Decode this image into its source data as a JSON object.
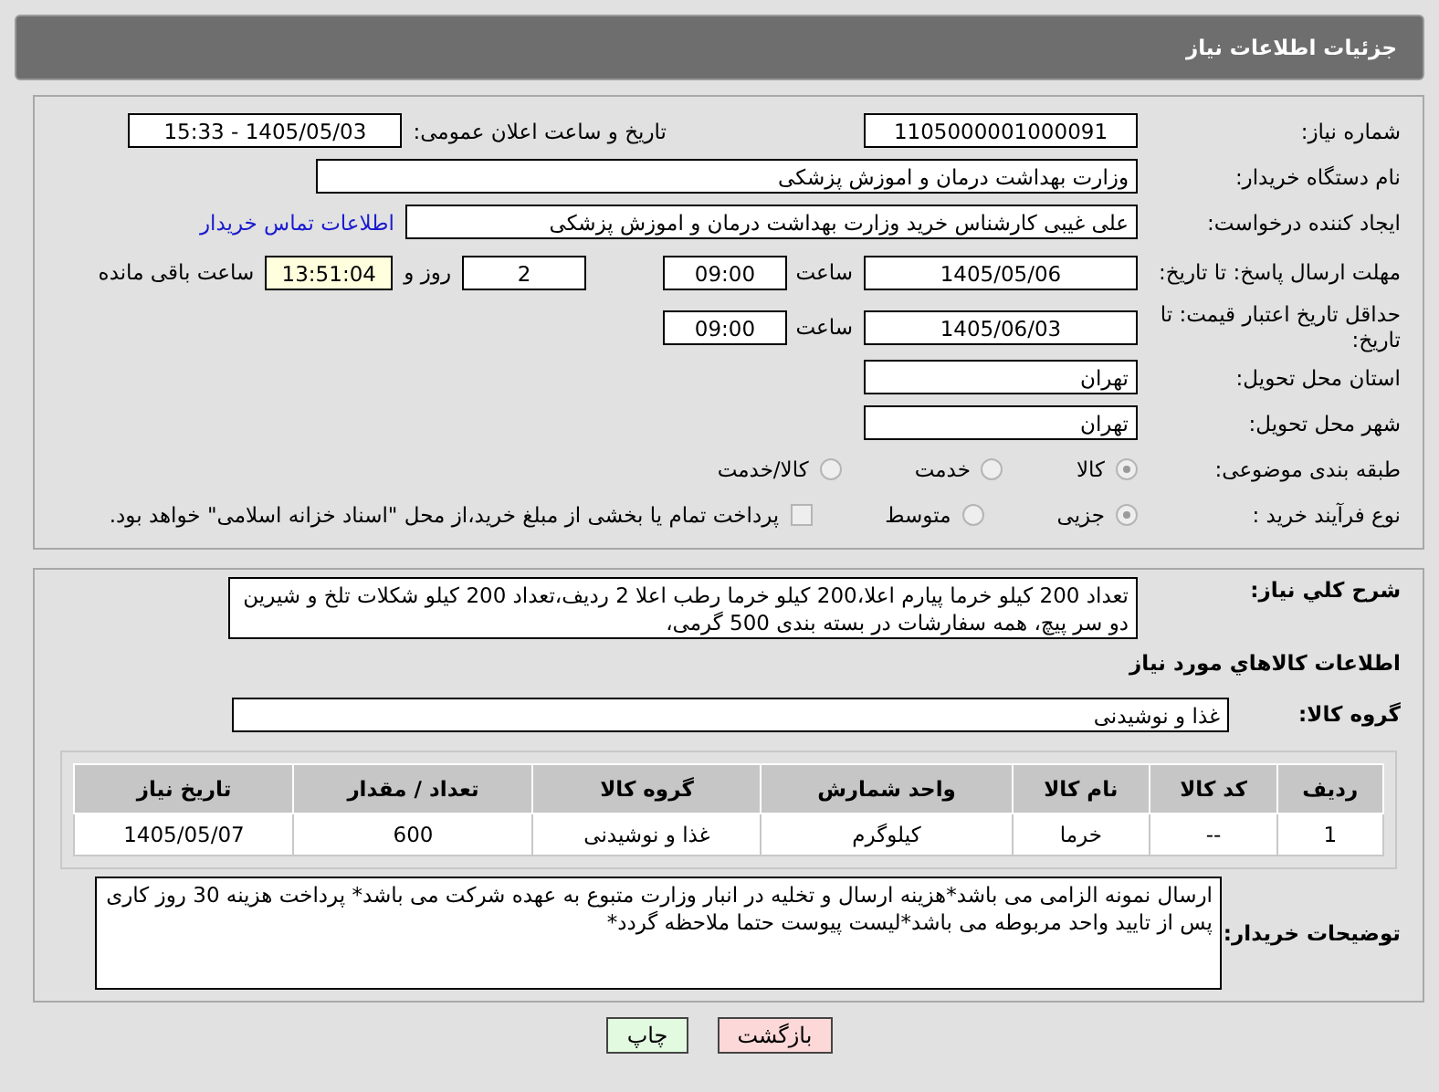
{
  "header": {
    "title": "جزئیات اطلاعات نیاز"
  },
  "need_number": {
    "label": "شماره نیاز:",
    "value": "1105000001000091"
  },
  "announce": {
    "label": "تاریخ و ساعت اعلان عمومی:",
    "value": "1405/05/03 - 15:33"
  },
  "buyer_org": {
    "label": "نام دستگاه خریدار:",
    "value": "وزارت بهداشت  درمان و اموزش پزشکی"
  },
  "requester": {
    "label": "ایجاد کننده درخواست:",
    "value": "علی غیبی کارشناس خرید وزارت بهداشت  درمان و اموزش پزشکی",
    "link": "اطلاعات تماس خریدار"
  },
  "deadline": {
    "label": "مهلت ارسال پاسخ: تا تاریخ:",
    "date": "1405/05/06",
    "time_label": "ساعت",
    "time": "09:00",
    "days": "2",
    "days_label": "روز و",
    "remaining": "13:51:04",
    "remaining_label": "ساعت باقی مانده"
  },
  "validity": {
    "label": "حداقل تاریخ اعتبار قیمت: تا تاریخ:",
    "date": "1405/06/03",
    "time_label": "ساعت",
    "time": "09:00"
  },
  "province": {
    "label": "استان محل تحویل:",
    "value": "تهران"
  },
  "city": {
    "label": "شهر محل تحویل:",
    "value": "تهران"
  },
  "category": {
    "label": "طبقه بندی موضوعی:",
    "options": [
      {
        "label": "کالا",
        "selected": true
      },
      {
        "label": "خدمت",
        "selected": false
      },
      {
        "label": "کالا/خدمت",
        "selected": false
      }
    ]
  },
  "process": {
    "label": "نوع فرآیند خرید :",
    "options": [
      {
        "label": "جزیی",
        "selected": true
      },
      {
        "label": "متوسط",
        "selected": false
      }
    ],
    "payment": {
      "label": "پرداخت تمام یا بخشی از مبلغ خرید،از محل \"اسناد خزانه اسلامی\" خواهد بود.",
      "checked": false
    }
  },
  "description": {
    "label": "شرح کلي نياز:",
    "value": "تعداد 200 کیلو خرما پیارم اعلا،200 کیلو خرما رطب اعلا 2 ردیف،تعداد 200 کیلو شکلات تلخ و شیرین دو سر پیچ، همه سفارشات در بسته بندی 500 گرمی،"
  },
  "goods_title": "اطلاعات کالاهاي مورد نياز",
  "goods_group": {
    "label": "گروه کالا:",
    "value": "غذا و نوشیدنی"
  },
  "table": {
    "columns": [
      "ردیف",
      "کد کالا",
      "نام کالا",
      "واحد شمارش",
      "گروه کالا",
      "تعداد / مقدار",
      "تاریخ نیاز"
    ],
    "rows": [
      [
        "1",
        "--",
        "خرما",
        "کیلوگرم",
        "غذا و نوشیدنی",
        "600",
        "1405/05/07"
      ]
    ]
  },
  "notes": {
    "label": "توضیحات خریدار:",
    "value": "ارسال نمونه الزامی می باشد*هزینه ارسال و تخلیه در انبار وزارت متبوع به عهده شرکت می باشد* پرداخت هزینه 30 روز کاری پس از تایید واحد مربوطه می باشد*لیست پیوست حتما ملاحظه گردد*"
  },
  "buttons": [
    {
      "label": "بازگشت",
      "kind": "back"
    },
    {
      "label": "چاپ",
      "kind": "print"
    }
  ]
}
